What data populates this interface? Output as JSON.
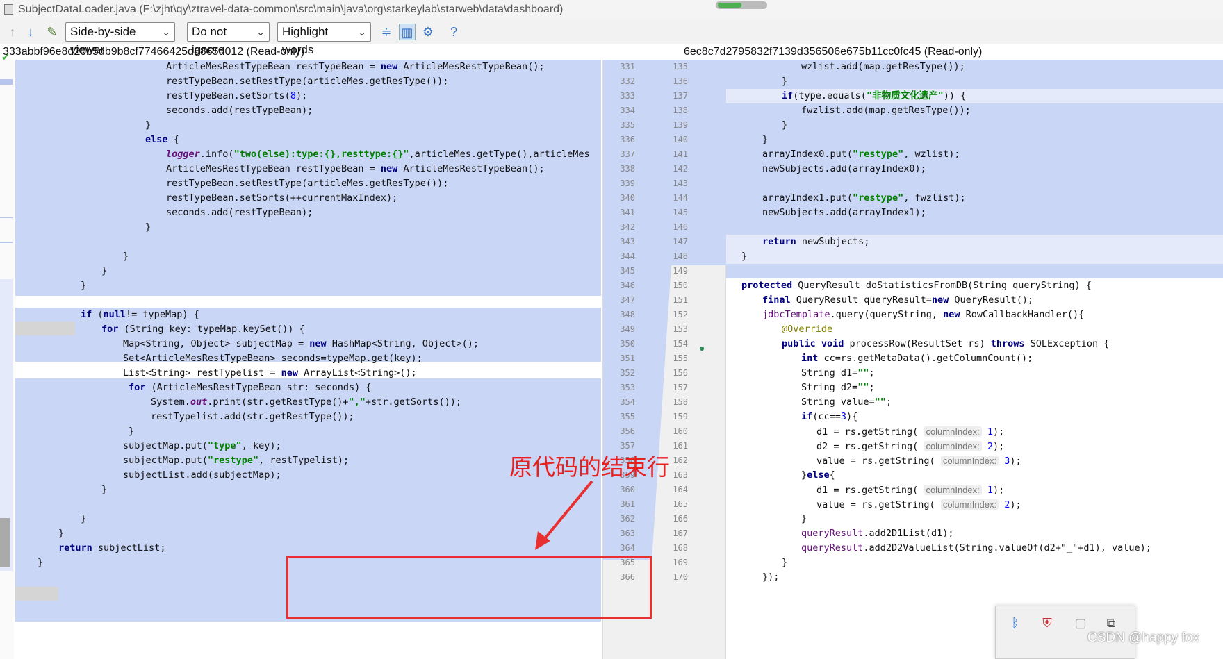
{
  "window": {
    "title": "SubjectDataLoader.java (F:\\zjht\\qy\\ztravel-data-common\\src\\main\\java\\org\\starkeylab\\starweb\\data\\dashboard)"
  },
  "toolbar": {
    "viewer_mode": "Side-by-side viewer",
    "whitespace_mode": "Do not ignore",
    "highlight_mode": "Highlight words"
  },
  "left_header": "333abbf96e8d20b5db9b8cf77466425d8865d012 (Read-only)",
  "right_header": "6ec8c7d2795832f7139d356506e675b11cc0fc45 (Read-only)",
  "left_line_numbers": [
    "331",
    "332",
    "333",
    "334",
    "335",
    "336",
    "337",
    "338",
    "339",
    "340",
    "341",
    "342",
    "343",
    "344",
    "345",
    "346",
    "347",
    "348",
    "349",
    "350",
    "351",
    "352",
    "353",
    "354",
    "355",
    "356",
    "357",
    "358",
    "359",
    "360",
    "361",
    "362",
    "363",
    "364",
    "365",
    "366"
  ],
  "right_line_numbers": [
    "135",
    "136",
    "137",
    "138",
    "139",
    "140",
    "141",
    "142",
    "143",
    "144",
    "145",
    "146",
    "147",
    "148",
    "149",
    "150",
    "151",
    "152",
    "153",
    "154",
    "155",
    "156",
    "157",
    "158",
    "159",
    "160",
    "161",
    "162",
    "163",
    "164",
    "165",
    "166",
    "167",
    "168",
    "169",
    "170"
  ],
  "annotation": {
    "text": "原代码的结束行"
  },
  "watermark": "CSDN @happy fox",
  "colors": {
    "diff_blue": "#cad6f5",
    "annotation_red": "#e83030",
    "keyword": "#000080",
    "string": "#008000"
  }
}
